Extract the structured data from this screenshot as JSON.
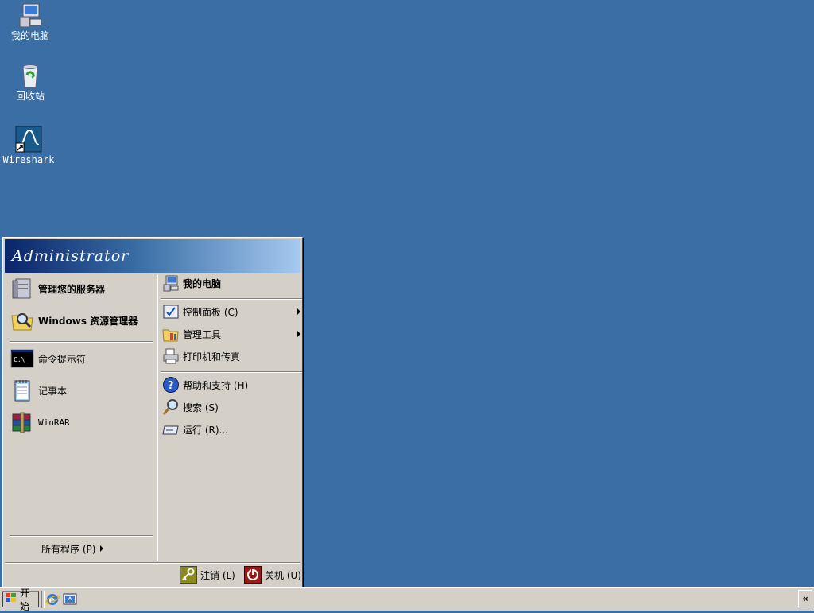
{
  "desktop": {
    "icons": [
      {
        "label": "我的电脑",
        "icon": "my-computer-icon"
      },
      {
        "label": "回收站",
        "icon": "recycle-bin-icon"
      },
      {
        "label": "Wireshark",
        "icon": "wireshark-icon"
      }
    ],
    "background_color": "#3a6ea5"
  },
  "start_menu": {
    "user": "Administrator",
    "left": {
      "pinned": [
        {
          "label": "管理您的服务器",
          "icon": "server-manage-icon"
        },
        {
          "label": "Windows 资源管理器",
          "icon": "explorer-icon"
        }
      ],
      "recent": [
        {
          "label": "命令提示符",
          "icon": "cmd-icon"
        },
        {
          "label": "记事本",
          "icon": "notepad-icon"
        },
        {
          "label": "WinRAR",
          "icon": "winrar-icon"
        }
      ],
      "all_programs": "所有程序 (P)"
    },
    "right": {
      "items": [
        {
          "label": "我的电脑",
          "icon": "my-computer-icon"
        },
        {
          "label": "控制面板 (C)",
          "icon": "control-panel-icon"
        },
        {
          "label": "管理工具",
          "icon": "admin-tools-icon"
        },
        {
          "label": "打印机和传真",
          "icon": "printer-icon"
        },
        {
          "label": "帮助和支持 (H)",
          "icon": "help-icon"
        },
        {
          "label": "搜索 (S)",
          "icon": "search-icon"
        },
        {
          "label": "运行 (R)...",
          "icon": "run-icon"
        }
      ]
    },
    "footer": {
      "logoff": "注销 (L)",
      "shutdown": "关机 (U)"
    }
  },
  "taskbar": {
    "start_label": "开始",
    "quick_launch": [
      "ie-icon",
      "show-desktop-icon"
    ],
    "tray_expand": "«"
  }
}
